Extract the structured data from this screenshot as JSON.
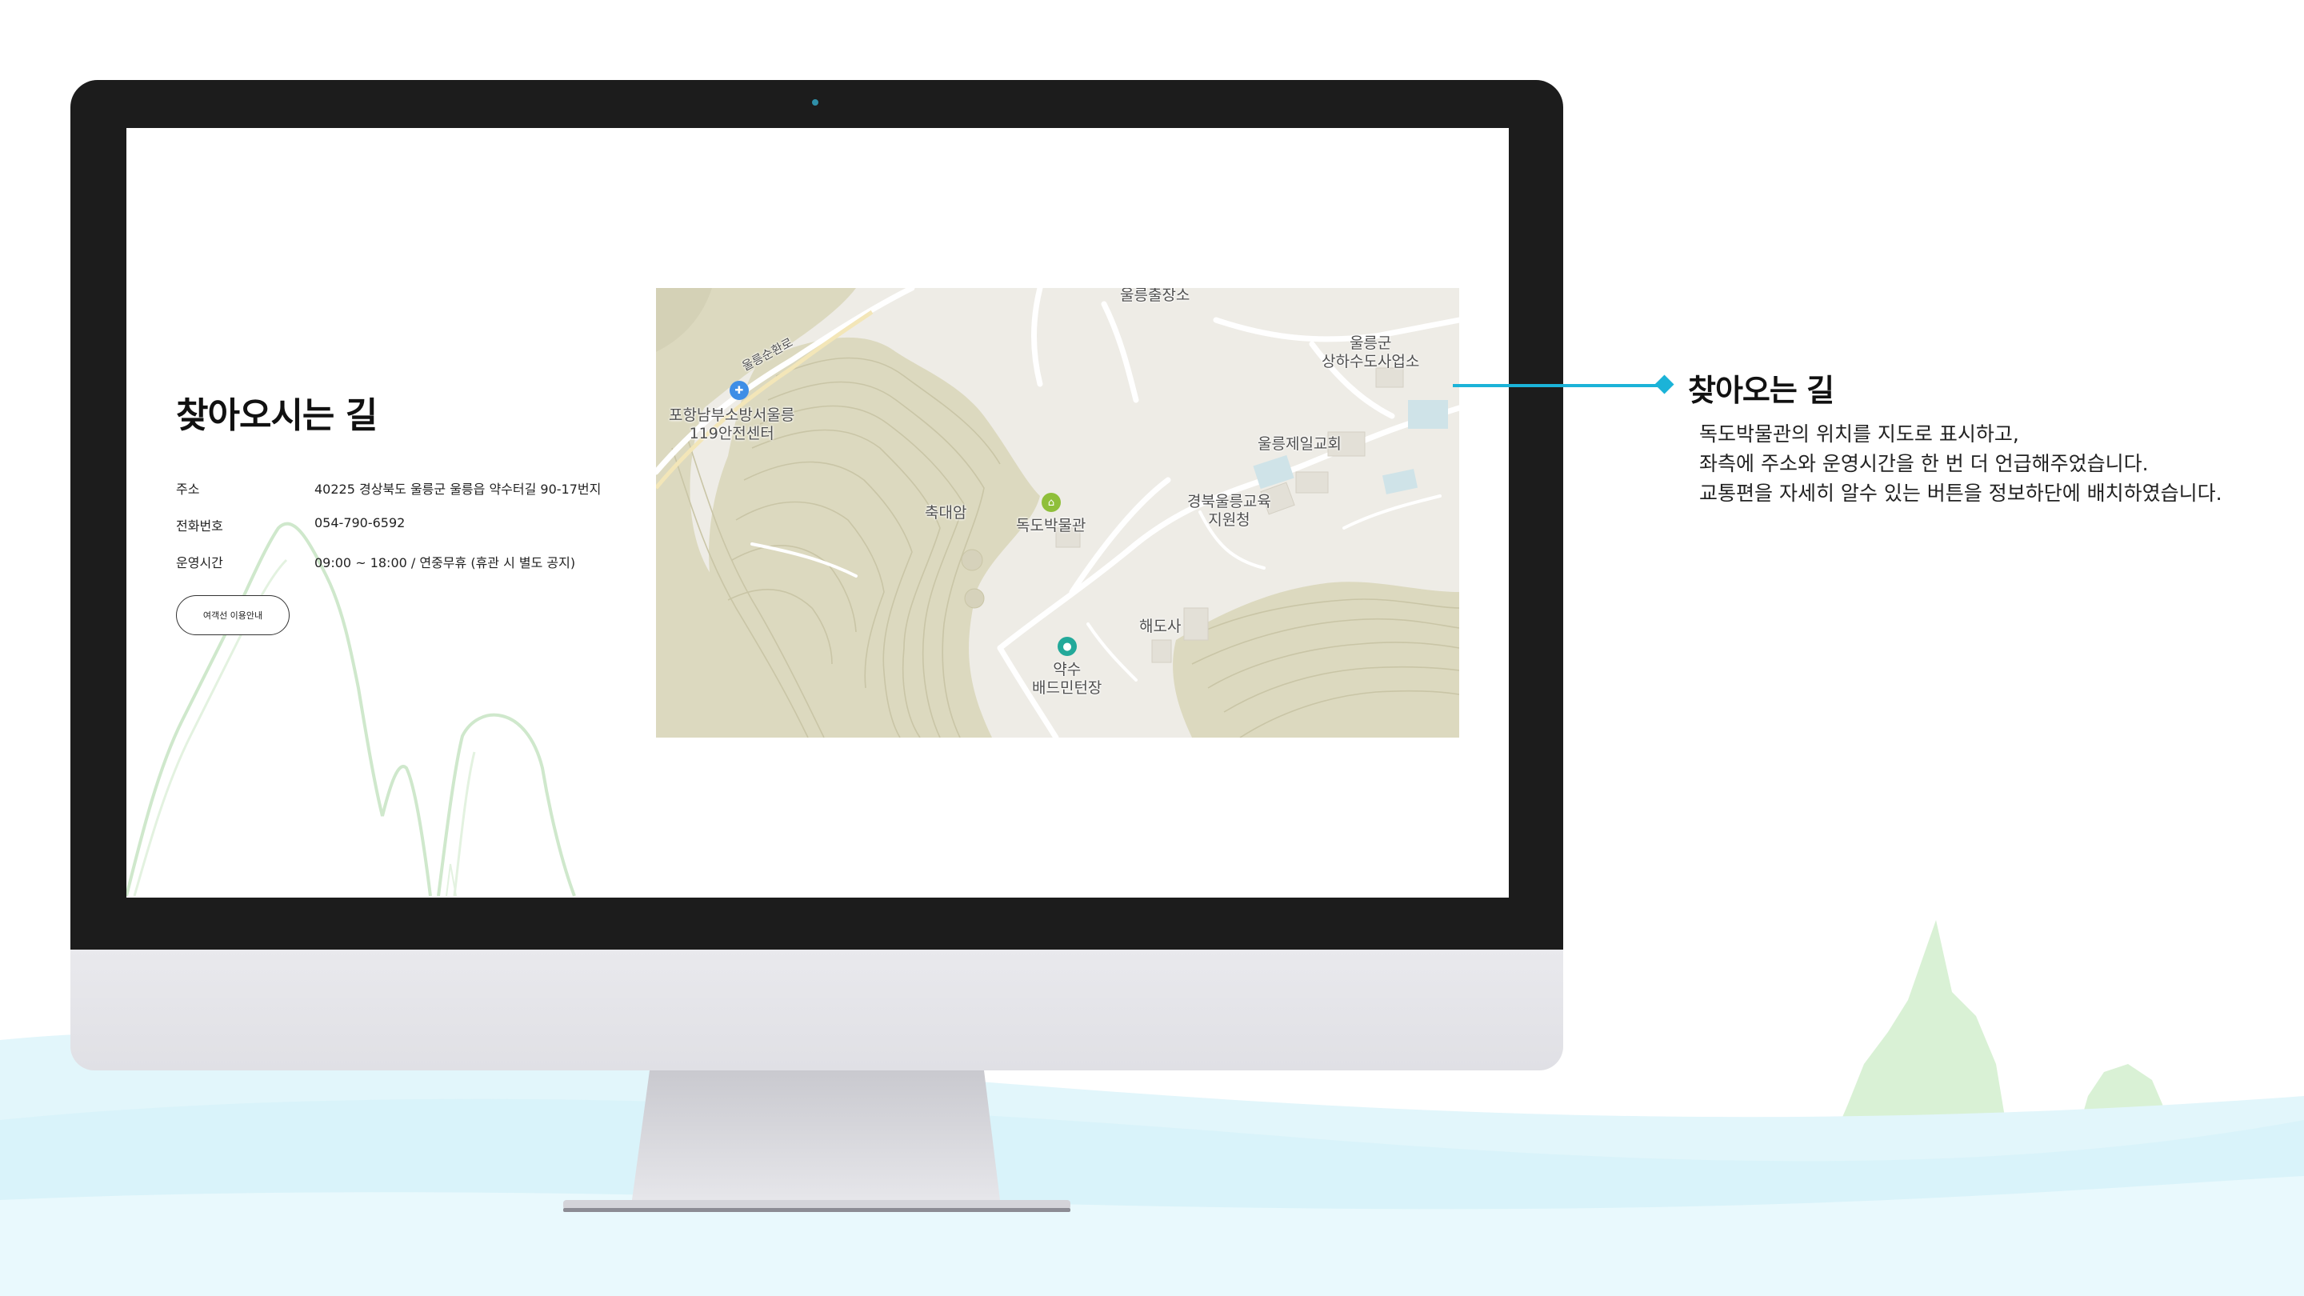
{
  "page": {
    "title": "찾아오시는 길",
    "info_rows": [
      {
        "label": "주소",
        "value": "40225 경상북도 울릉군 울릉읍 약수터길 90-17번지"
      },
      {
        "label": "전화번호",
        "value": "054-790-6592"
      },
      {
        "label": "운영시간",
        "value": "09:00 ~ 18:00 / 연중무휴 (휴관 시 별도 공지)"
      }
    ],
    "ferry_button": "여객선 이용안내"
  },
  "map": {
    "labels": {
      "ulleung_substation": "울릉출장소",
      "road_name": "울릉순환로",
      "fire_station_line1": "포항남부소방서울릉",
      "fire_station_line2": "119안전센터",
      "waterworks_line1": "울릉군",
      "waterworks_line2": "상하수도사업소",
      "church": "울릉제일교회",
      "education_line1": "경북울릉교육",
      "education_line2": "지원청",
      "chukdaeam": "축대암",
      "dokdo_museum": "독도박물관",
      "haedosa": "해도사",
      "yaksu_line1": "약수",
      "yaksu_line2": "배드민턴장"
    },
    "icons": {
      "fire_station": "fire-station-icon",
      "museum": "museum-icon",
      "sports": "badminton-icon"
    },
    "colors": {
      "terrain": "#dcd9bf",
      "background": "#eeece6",
      "museum_pin": "#8fbf3a",
      "sports_pin": "#23a99a",
      "fire_pin": "#3e8ee6"
    }
  },
  "annotation": {
    "title": "찾아오는 길",
    "lines": [
      "독도박물관의 위치를 지도로 표시하고,",
      "좌측에 주소와 운영시간을 한 번 더 언급해주었습니다.",
      "교통편을 자세히 알수 있는 버튼을 정보하단에 배치하였습니다."
    ],
    "accent_color": "#1bb3d8"
  }
}
